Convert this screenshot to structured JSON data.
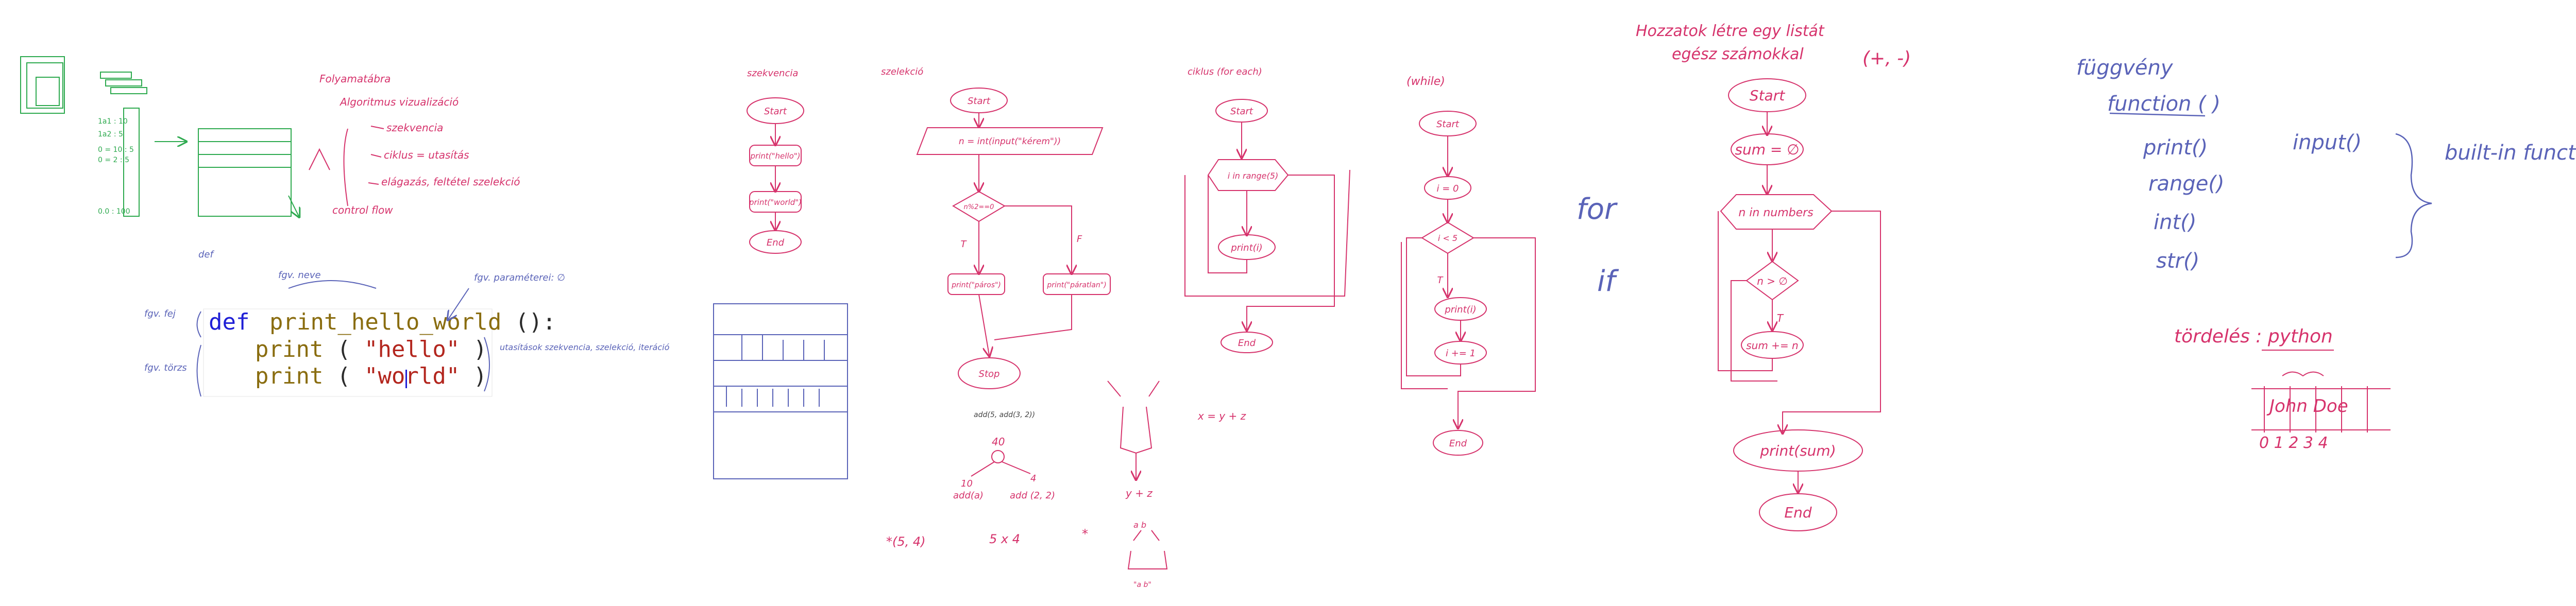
{
  "colors": {
    "pink": "#d6336c",
    "blue": "#5a63b8",
    "green": "#2eaa4f",
    "code_blue": "#1f1fd6",
    "code_brown": "#8a6d10",
    "code_red": "#b3261e",
    "code_default": "#2b2b2b"
  },
  "notes": {
    "folyamatabra": "Folyamatábra",
    "alg": "Algoritmus vizualizáció",
    "szekvencia": "szekvencia",
    "ciklus": "ciklus = utasítás",
    "elagazas": "elágazás, feltétel szelekció",
    "control_flow": "control flow",
    "fgv_nev": "fgv. neve",
    "fgv_param": "fgv. paraméterei: ∅",
    "fgv_fej": "fgv. fej",
    "fgv_torzs": "fgv. törzs",
    "def_label": "def",
    "torzs_utasitas": "utasítások szekvencia, szelekció, iteráció"
  },
  "code": {
    "def": "def",
    "fn_name": "print_hello_world",
    "fn_rest": "():",
    "print": "print",
    "open": "(",
    "hello": "\"hello\"",
    "world": "\"world\"",
    "close": ")"
  },
  "flow_seq": {
    "title": "szekvencia",
    "start": "Start",
    "print1": "print(\"hello\")",
    "print2": "print(\"world\")",
    "end": "End"
  },
  "flow_sel": {
    "title": "szelekció",
    "start": "Start",
    "input": "n = int(input(\"kérem\"))",
    "cond": "n%2==0",
    "t": "T",
    "f": "F",
    "even": "print(\"páros\")",
    "odd": "print(\"páratlan\")",
    "stop": "Stop"
  },
  "flow_for": {
    "title": "ciklus (for each)",
    "start": "Start",
    "loop": "i in range(5)",
    "body": "print(i)",
    "end": "End"
  },
  "flow_while": {
    "title": "(while)",
    "start": "Start",
    "init": "i = 0",
    "cond": "i < 5",
    "t": "T",
    "body": "print(i)",
    "inc": "i += 1",
    "end": "End"
  },
  "side_words": {
    "for": "for",
    "if": "if"
  },
  "add_notes": {
    "add_call": "add(5, add(3, 2))",
    "forty": "40",
    "ten": "10",
    "four": "4",
    "add_a": "add(a)",
    "add_b": "add (2, 2)",
    "star": "*(5, 4)",
    "five_x_four": "5 x 4",
    "y_plus_z": "y + z",
    "x_eq": "x = y + z",
    "ab": "a  b",
    "a_b_label": "\"a b\""
  },
  "flow_sum": {
    "title1": "Hozzatok létre egy listát",
    "title2": "egész számokkal",
    "title_sign": "(+, -)",
    "start": "Start",
    "init": "sum = ∅",
    "loop": "n in numbers",
    "cond": "n > ∅",
    "t": "T",
    "acc": "sum += n",
    "print": "print(sum)",
    "end": "End"
  },
  "functions": {
    "fuggveny": "függvény",
    "function": "function ( )",
    "print": "print()",
    "range": "range()",
    "int": "int()",
    "str": "str()",
    "input": "input()",
    "builtin": "built-in function",
    "tordeles": "tördelés : python",
    "name": "John Doe",
    "indices": "0 1 2 3 4"
  }
}
